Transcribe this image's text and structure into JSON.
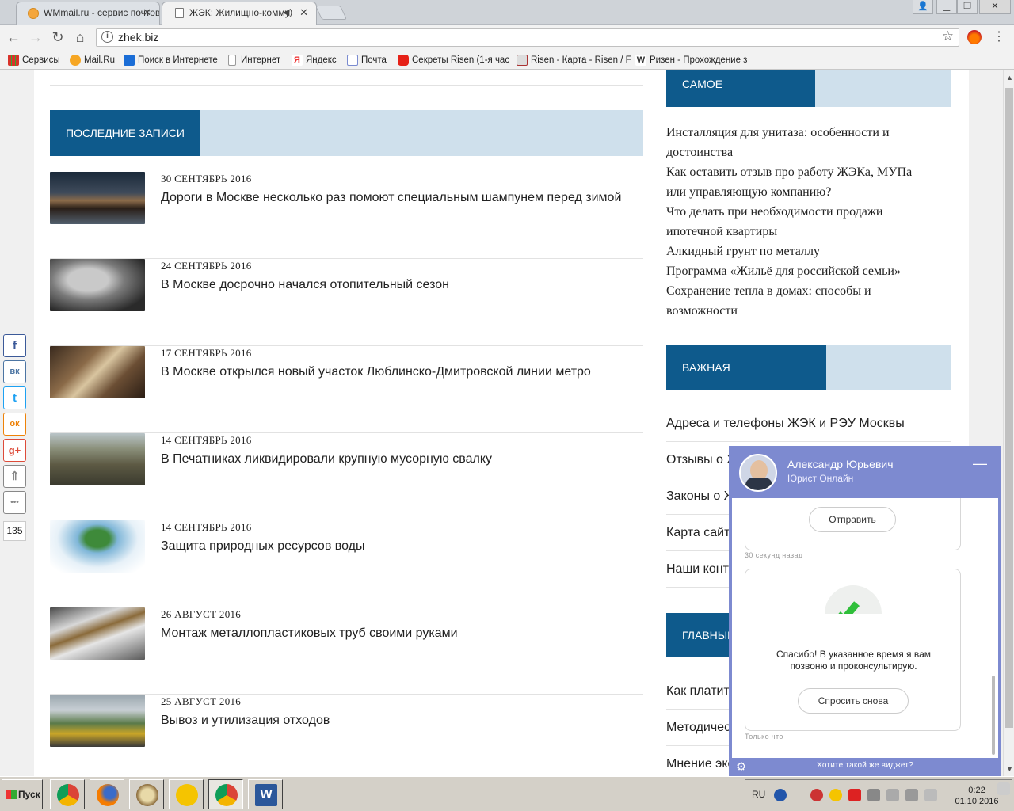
{
  "browser": {
    "tabs": [
      {
        "title": "WMmail.ru - сервис почтов"
      },
      {
        "title": "ЖЭК: Жилищно-комму"
      }
    ],
    "url": "zhek.biz",
    "bookmarks": [
      {
        "label": "Сервисы",
        "icon": "apps-icon",
        "color": "#d9322a"
      },
      {
        "label": "Mail.Ru",
        "icon": "mailru-icon",
        "color": "#f6a623"
      },
      {
        "label": "Поиск в Интернете",
        "icon": "search-icon",
        "color": "#1a6dd6"
      },
      {
        "label": "Интернет",
        "icon": "page-icon",
        "color": "#999999"
      },
      {
        "label": "Яндекс",
        "icon": "yandex-icon",
        "color": "#e33"
      },
      {
        "label": "Почта",
        "icon": "mail-icon",
        "color": "#7a8bd0"
      },
      {
        "label": "Секреты Risen (1-я час",
        "icon": "youtube-icon",
        "color": "#e62117"
      },
      {
        "label": "Risen - Карта - Risen / F",
        "icon": "rpg-icon",
        "color": "#a33"
      },
      {
        "label": "Ризен - Прохождение з",
        "icon": "w-icon",
        "color": "#333"
      }
    ]
  },
  "page": {
    "recent_heading": "ПОСЛЕДНИЕ ЗАПИСИ",
    "posts": [
      {
        "date": "30 СЕНТЯБРЬ 2016",
        "title": "Дороги в Москве несколько раз помоют специальным шампунем перед зимой",
        "thumb": "street-cleaning-photo"
      },
      {
        "date": "24 СЕНТЯБРЬ 2016",
        "title": "В Москве досрочно начался отопительный сезон",
        "thumb": "cat-on-radiator-photo"
      },
      {
        "date": "17 СЕНТЯБРЬ 2016",
        "title": "В Москве открылся новый участок Люблинско-Дмитровской линии метро",
        "thumb": "metro-tunnel-photo"
      },
      {
        "date": "14 СЕНТЯБРЬ 2016",
        "title": "В Печатниках ликвидировали крупную мусорную свалку",
        "thumb": "garbage-dump-photo"
      },
      {
        "date": "14 СЕНТЯБРЬ 2016",
        "title": "Защита природных ресурсов воды",
        "thumb": "water-hands-photo"
      },
      {
        "date": "26 АВГУСТ 2016",
        "title": "Монтаж металлопластиковых труб своими руками",
        "thumb": "pipes-photo"
      },
      {
        "date": "25 АВГУСТ 2016",
        "title": "Вывоз и утилизация отходов",
        "thumb": "waste-warehouse-photo"
      }
    ],
    "popular_heading": "САМОЕ ПОПУЛЯРНОЕ",
    "popular": [
      "Инсталляция для унитаза: особенности и достоинства",
      "Как оставить отзыв про работу ЖЭКа, МУПа или управляющую компанию?",
      "Что делать при необходимости продажи ипотечной квартиры",
      "Алкидный грунт по металлу",
      "Программа «Жильё для российской семьи»",
      "Сохранение тепла в домах: способы и возможности"
    ],
    "important_heading": "ВАЖНАЯ ИНФОРМАЦИЯ",
    "important": [
      "Адреса и телефоны ЖЭК и РЭУ Москвы",
      "Отзывы о Ж",
      "Законы о Ж",
      "Карта сайт",
      "Наши конта"
    ],
    "main_heading": "ГЛАВНЫЕ",
    "main_links": [
      "Как платить",
      "Методичес",
      "Мнение экс"
    ],
    "share_count": "135",
    "share_buttons": [
      {
        "name": "facebook",
        "glyph": "f",
        "color": "#3b5998"
      },
      {
        "name": "vkontakte",
        "glyph": "вк",
        "color": "#4c75a3"
      },
      {
        "name": "twitter",
        "glyph": "t",
        "color": "#1da1f2"
      },
      {
        "name": "odnoklassniki",
        "glyph": "ок",
        "color": "#ee8208"
      },
      {
        "name": "googleplus",
        "glyph": "g+",
        "color": "#dd4b39"
      },
      {
        "name": "scroll-top",
        "glyph": "⇑",
        "color": "#888888"
      },
      {
        "name": "more",
        "glyph": "•••",
        "color": "#888888"
      }
    ]
  },
  "widget": {
    "name": "Александр Юрьевич",
    "role": "Юрист Онлайн",
    "send_label": "Отправить",
    "ts1": "30 секунд назад",
    "thanks": "Спасибо! В указанное время я вам позвоню и проконсультирую.",
    "ask_again_label": "Спросить снова",
    "ts2": "Только что",
    "promo": "Хотите такой же виджет?"
  },
  "taskbar": {
    "start_label": "Пуск",
    "lang": "RU",
    "time": "0:22",
    "date": "01.10.2016"
  }
}
